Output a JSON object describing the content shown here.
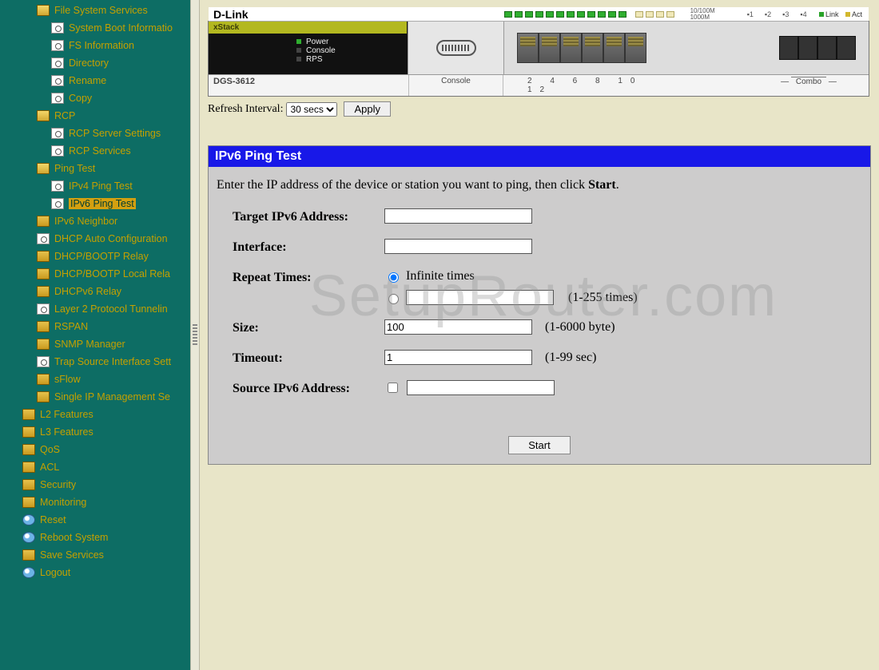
{
  "sidebar": {
    "items": [
      {
        "indent": 2,
        "icon": "folder-open",
        "label": "File System Services"
      },
      {
        "indent": 3,
        "icon": "doc",
        "label": "System Boot Informatio"
      },
      {
        "indent": 3,
        "icon": "doc",
        "label": "FS Information"
      },
      {
        "indent": 3,
        "icon": "doc",
        "label": "Directory"
      },
      {
        "indent": 3,
        "icon": "doc",
        "label": "Rename"
      },
      {
        "indent": 3,
        "icon": "doc",
        "label": "Copy"
      },
      {
        "indent": 2,
        "icon": "folder-open",
        "label": "RCP"
      },
      {
        "indent": 3,
        "icon": "doc",
        "label": "RCP Server Settings"
      },
      {
        "indent": 3,
        "icon": "doc",
        "label": "RCP Services"
      },
      {
        "indent": 2,
        "icon": "folder-open",
        "label": "Ping Test"
      },
      {
        "indent": 3,
        "icon": "doc",
        "label": "IPv4 Ping Test"
      },
      {
        "indent": 3,
        "icon": "doc",
        "label": "IPv6 Ping Test",
        "selected": true
      },
      {
        "indent": 2,
        "icon": "folder-closed",
        "label": "IPv6 Neighbor"
      },
      {
        "indent": 2,
        "icon": "doc",
        "label": "DHCP Auto Configuration"
      },
      {
        "indent": 2,
        "icon": "folder-closed",
        "label": "DHCP/BOOTP Relay"
      },
      {
        "indent": 2,
        "icon": "folder-closed",
        "label": "DHCP/BOOTP Local Rela"
      },
      {
        "indent": 2,
        "icon": "folder-closed",
        "label": "DHCPv6 Relay"
      },
      {
        "indent": 2,
        "icon": "doc",
        "label": "Layer 2 Protocol Tunnelin"
      },
      {
        "indent": 2,
        "icon": "folder-closed",
        "label": "RSPAN"
      },
      {
        "indent": 2,
        "icon": "folder-closed",
        "label": "SNMP Manager"
      },
      {
        "indent": 2,
        "icon": "doc",
        "label": "Trap Source Interface Sett"
      },
      {
        "indent": 2,
        "icon": "folder-closed",
        "label": "sFlow"
      },
      {
        "indent": 2,
        "icon": "folder-closed",
        "label": "Single IP Management Se"
      },
      {
        "indent": 1,
        "icon": "folder-closed",
        "label": "L2 Features"
      },
      {
        "indent": 1,
        "icon": "folder-closed",
        "label": "L3 Features"
      },
      {
        "indent": 1,
        "icon": "folder-closed",
        "label": "QoS"
      },
      {
        "indent": 1,
        "icon": "folder-closed",
        "label": "ACL"
      },
      {
        "indent": 1,
        "icon": "folder-closed",
        "label": "Security"
      },
      {
        "indent": 1,
        "icon": "folder-closed",
        "label": "Monitoring"
      },
      {
        "indent": 1,
        "icon": "globe",
        "label": "Reset"
      },
      {
        "indent": 1,
        "icon": "globe",
        "label": "Reboot System"
      },
      {
        "indent": 1,
        "icon": "folder-closed",
        "label": "Save Services"
      },
      {
        "indent": 1,
        "icon": "globe",
        "label": "Logout"
      }
    ]
  },
  "device": {
    "brand": "D-Link",
    "xstack": "xStack",
    "model": "DGS-3612",
    "status": {
      "power": "Power",
      "console": "Console",
      "rps": "RPS"
    },
    "console_label": "Console",
    "port_numbers": "2 4 6 8 10 12",
    "combo_label": "Combo",
    "speed_lines": [
      "10/100M",
      "1000M"
    ],
    "modes": [
      "1",
      "2",
      "3",
      "4"
    ],
    "link_label": "Link",
    "act_label": "Act"
  },
  "refresh": {
    "label": "Refresh Interval:",
    "value": "30 secs",
    "apply": "Apply"
  },
  "panel": {
    "title": "IPv6 Ping Test",
    "instruction_pre": "Enter the IP address of the device or station you want to ping, then click ",
    "instruction_bold": "Start",
    "instruction_post": "."
  },
  "form": {
    "target_label": "Target IPv6 Address:",
    "target_value": "",
    "interface_label": "Interface:",
    "interface_value": "",
    "repeat_label": "Repeat Times:",
    "repeat_infinite_label": "Infinite times",
    "repeat_selected": "infinite",
    "repeat_count_value": "",
    "repeat_hint": "(1-255 times)",
    "size_label": "Size:",
    "size_value": "100",
    "size_hint": "(1-6000 byte)",
    "timeout_label": "Timeout:",
    "timeout_value": "1",
    "timeout_hint": "(1-99 sec)",
    "source_label": "Source IPv6 Address:",
    "source_enabled": false,
    "source_value": "",
    "start": "Start"
  },
  "watermark": "SetupRouter.com"
}
